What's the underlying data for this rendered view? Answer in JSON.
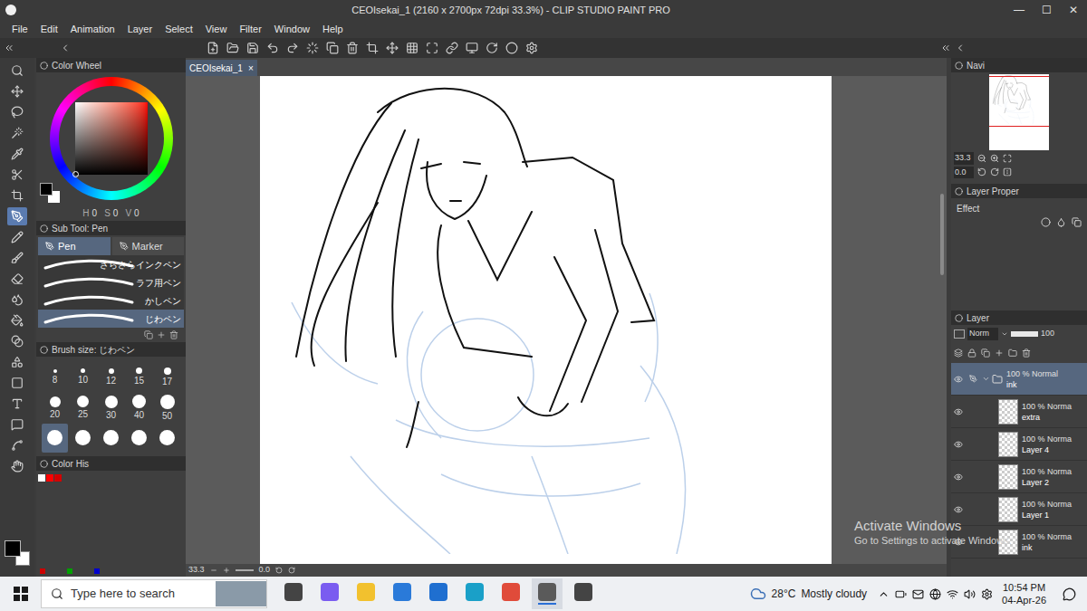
{
  "window": {
    "title": "CEOIsekai_1 (2160 x 2700px 72dpi 33.3%) - CLIP STUDIO PAINT PRO",
    "controls": [
      "—",
      "☐",
      "✕"
    ]
  },
  "menu": [
    "File",
    "Edit",
    "Animation",
    "Layer",
    "Select",
    "View",
    "Filter",
    "Window",
    "Help"
  ],
  "tools": [
    {
      "selected": false
    },
    {
      "selected": false
    },
    {
      "selected": false
    },
    {
      "selected": false
    },
    {
      "selected": false
    },
    {
      "selected": false
    },
    {
      "selected": false
    },
    {
      "selected": true
    },
    {
      "selected": false
    },
    {
      "selected": false
    },
    {
      "selected": false
    },
    {
      "selected": false
    },
    {
      "selected": false
    },
    {
      "selected": false
    },
    {
      "selected": false
    },
    {
      "selected": false
    },
    {
      "selected": false
    },
    {
      "selected": false
    },
    {
      "selected": false
    },
    {
      "selected": false
    }
  ],
  "color_wheel": {
    "title": "Color Wheel",
    "hsv": [
      {
        "label": "H",
        "value": "0"
      },
      {
        "label": "S",
        "value": "0"
      },
      {
        "label": "V",
        "value": "0"
      }
    ]
  },
  "sub_tool": {
    "title": "Sub Tool: Pen",
    "tabs": [
      {
        "label": "Pen",
        "selected": true
      },
      {
        "label": "Marker",
        "selected": false
      }
    ],
    "brushes": [
      {
        "name": "さらさらインクペン",
        "selected": false
      },
      {
        "name": "ラフ用ペン",
        "selected": false
      },
      {
        "name": "かしペン",
        "selected": false
      },
      {
        "name": "じわペン",
        "selected": true
      }
    ]
  },
  "brush_size": {
    "title": "Brush size: じわペン",
    "sizes": [
      {
        "label": "8",
        "selected": false
      },
      {
        "label": "10",
        "selected": false
      },
      {
        "label": "12",
        "selected": false
      },
      {
        "label": "15",
        "selected": false
      },
      {
        "label": "17",
        "selected": false
      },
      {
        "label": "20",
        "selected": false
      },
      {
        "label": "25",
        "selected": false
      },
      {
        "label": "30",
        "selected": false
      },
      {
        "label": "40",
        "selected": false
      },
      {
        "label": "50",
        "selected": false
      },
      {
        "label": "",
        "selected": true
      },
      {
        "label": "",
        "selected": false
      },
      {
        "label": "",
        "selected": false
      },
      {
        "label": "",
        "selected": false
      },
      {
        "label": "",
        "selected": false
      }
    ]
  },
  "color_history": {
    "title": "Color His",
    "swatches": [
      {
        "color": "#ffffff"
      },
      {
        "color": "#ff0000"
      },
      {
        "color": "#d40000"
      }
    ]
  },
  "palette": [
    {
      "color": "#cc0000"
    },
    {
      "color": "#00a000"
    },
    {
      "color": "#0000cc"
    }
  ],
  "canvas": {
    "tab": "CEOIsekai_1",
    "close": "×",
    "zoom": "33.3",
    "angle": "0.0"
  },
  "navigator": {
    "title": "Navi",
    "zoom": "33.3",
    "angle": "0.0"
  },
  "layer_property": {
    "title": "Layer Proper",
    "effect": "Effect"
  },
  "layer_panel": {
    "title": "Layer",
    "blend_mode": "Norm",
    "opacity": "100",
    "layers": [
      {
        "info": "100 % Normal",
        "name": "ink",
        "kind": "folder",
        "selected": true,
        "visible": true,
        "expanded": true
      },
      {
        "info": "100 % Norma",
        "name": "extra",
        "kind": "layer",
        "selected": false,
        "visible": true,
        "expanded": false
      },
      {
        "info": "100 % Norma",
        "name": "Layer 4",
        "kind": "layer",
        "selected": false,
        "visible": true,
        "expanded": false
      },
      {
        "info": "100 % Norma",
        "name": "Layer 2",
        "kind": "layer",
        "selected": false,
        "visible": true,
        "expanded": false
      },
      {
        "info": "100 % Norma",
        "name": "Layer 1",
        "kind": "layer",
        "selected": false,
        "visible": true,
        "expanded": false
      },
      {
        "info": "100 % Norma",
        "name": "ink",
        "kind": "layer",
        "selected": false,
        "visible": true,
        "expanded": false
      }
    ]
  },
  "watermark": {
    "title": "Activate Windows",
    "subtitle": "Go to Settings to activate Windows."
  },
  "taskbar": {
    "search": "Type here to search",
    "apps": [
      {
        "active": false
      },
      {
        "active": false
      },
      {
        "active": false
      },
      {
        "active": false
      },
      {
        "active": false
      },
      {
        "active": false
      },
      {
        "active": false
      },
      {
        "active": true
      },
      {
        "active": false
      }
    ],
    "temperature": "28°C",
    "weather": "Mostly cloudy",
    "time": "10:54 PM",
    "date": "04-Apr-26"
  }
}
